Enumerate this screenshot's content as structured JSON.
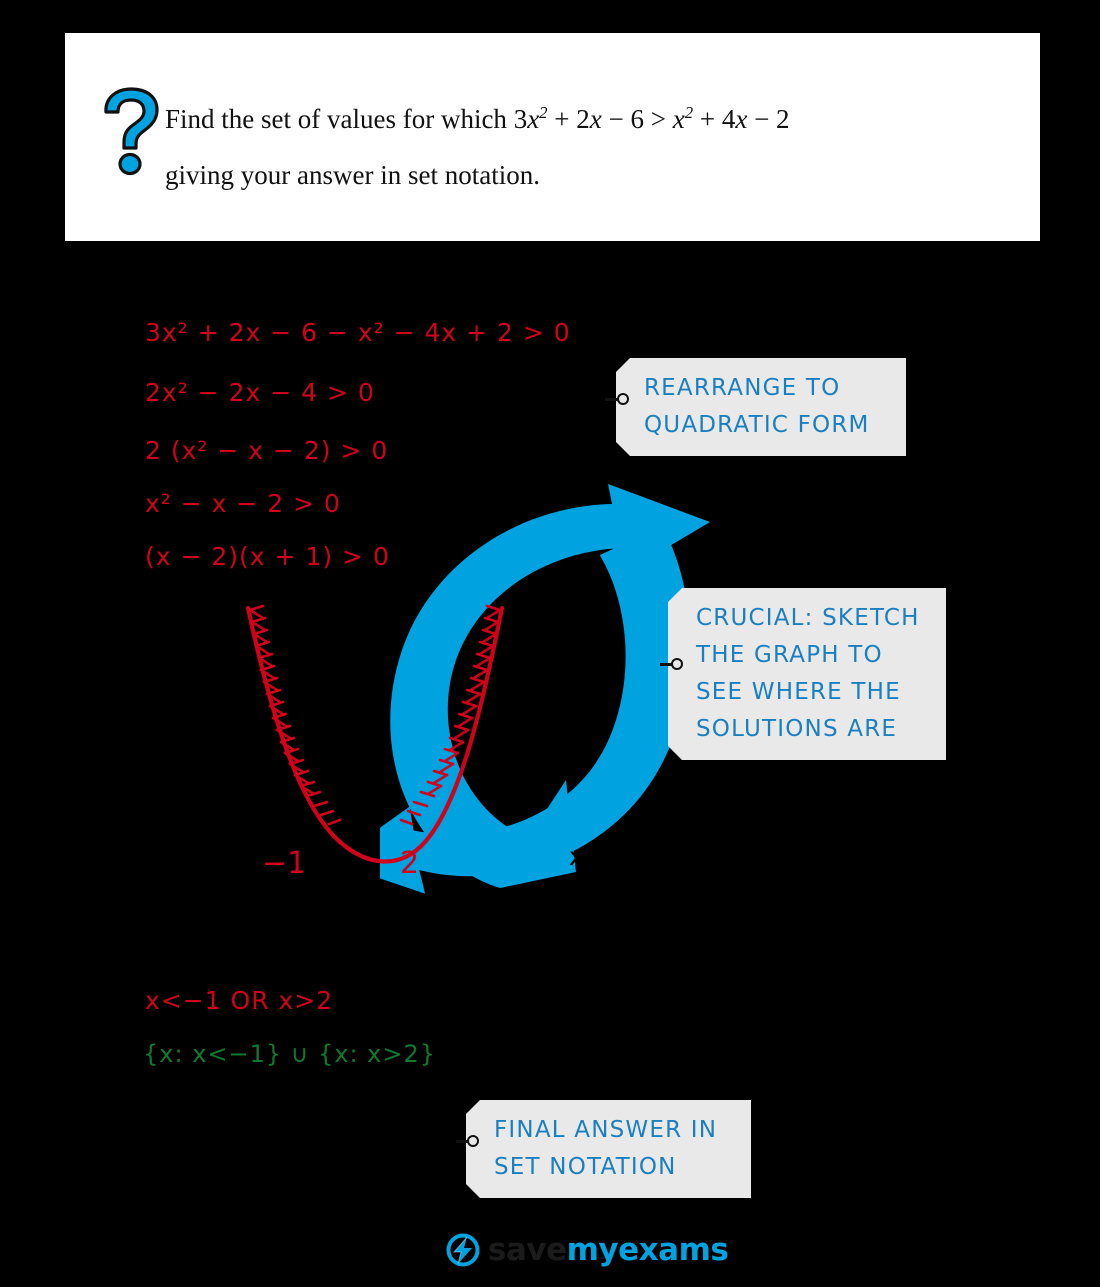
{
  "page": {
    "background": "#000000",
    "accent_blue": "#00a3e0",
    "tag_text_blue": "#1a7fc1",
    "working_red": "#d0021b",
    "answer_green": "#0f7a2e"
  },
  "question": {
    "icon": "question-mark-icon",
    "line1_prefix": "Find the set of values for which ",
    "expr_left": "3x2 + 2x − 6",
    "relation": " > ",
    "expr_right": "x2 + 4x − 2",
    "line2": "giving your answer in set notation."
  },
  "working": {
    "steps": [
      "3x² + 2x − 6 − x² − 4x + 2 > 0",
      "2x² − 2x − 4 > 0",
      "2 (x² − x − 2) > 0",
      "x² − x − 2 > 0",
      "(x − 2)(x + 1) > 0"
    ]
  },
  "answers": {
    "inequality": "x<−1  OR  x>2",
    "set_notation": "{x: x<−1} ∪ {x: x>2}"
  },
  "graph": {
    "root_left_label": "−1",
    "root_right_label": "2",
    "axis_label": "x",
    "curve_color": "#d0021b",
    "roots": [
      -1,
      2
    ],
    "description": "sketch of y = x² − x − 2 parabola with hatched arms above x-axis"
  },
  "callouts": [
    {
      "id": "rearrange",
      "lines": [
        "REARRANGE  TO",
        "QUADRATIC  FORM"
      ]
    },
    {
      "id": "sketch-graph",
      "lines": [
        "CRUCIAL: SKETCH",
        "THE  GRAPH  TO",
        "SEE  WHERE  THE",
        "SOLUTIONS   ARE"
      ]
    },
    {
      "id": "final-answer",
      "lines": [
        "FINAL  ANSWER  IN",
        "SET  NOTATION"
      ]
    }
  ],
  "footer": {
    "logo_icon": "lightning-bolt-circle-icon",
    "word_save": "save",
    "word_my": "my",
    "word_exams": "exams"
  }
}
